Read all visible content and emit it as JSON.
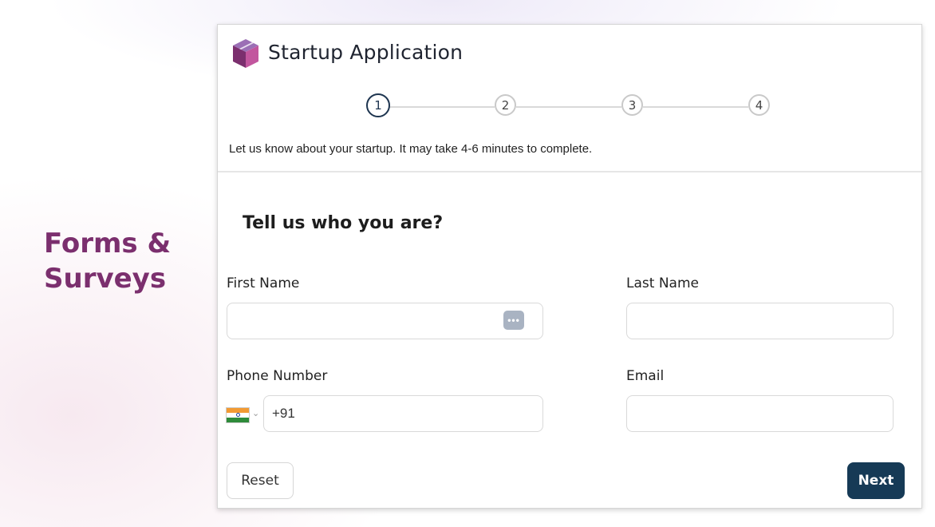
{
  "side_heading": {
    "line1": "Forms &",
    "line2": "Surveys"
  },
  "header": {
    "title": "Startup Application"
  },
  "stepper": {
    "steps": [
      "1",
      "2",
      "3",
      "4"
    ],
    "active_step": 1
  },
  "intro_text": "Let us know about your startup. It may take 4-6 minutes to complete.",
  "section_title": "Tell us who you are?",
  "form": {
    "first_name": {
      "label": "First Name",
      "value": ""
    },
    "last_name": {
      "label": "Last Name",
      "value": ""
    },
    "phone": {
      "label": "Phone Number",
      "value": "+91",
      "country_flag": "india-flag-icon"
    },
    "email": {
      "label": "Email",
      "value": ""
    }
  },
  "buttons": {
    "reset": "Reset",
    "next": "Next"
  },
  "colors": {
    "accent": "#7b2f6e",
    "primary_button": "#163a56",
    "active_step": "#1e3550"
  }
}
